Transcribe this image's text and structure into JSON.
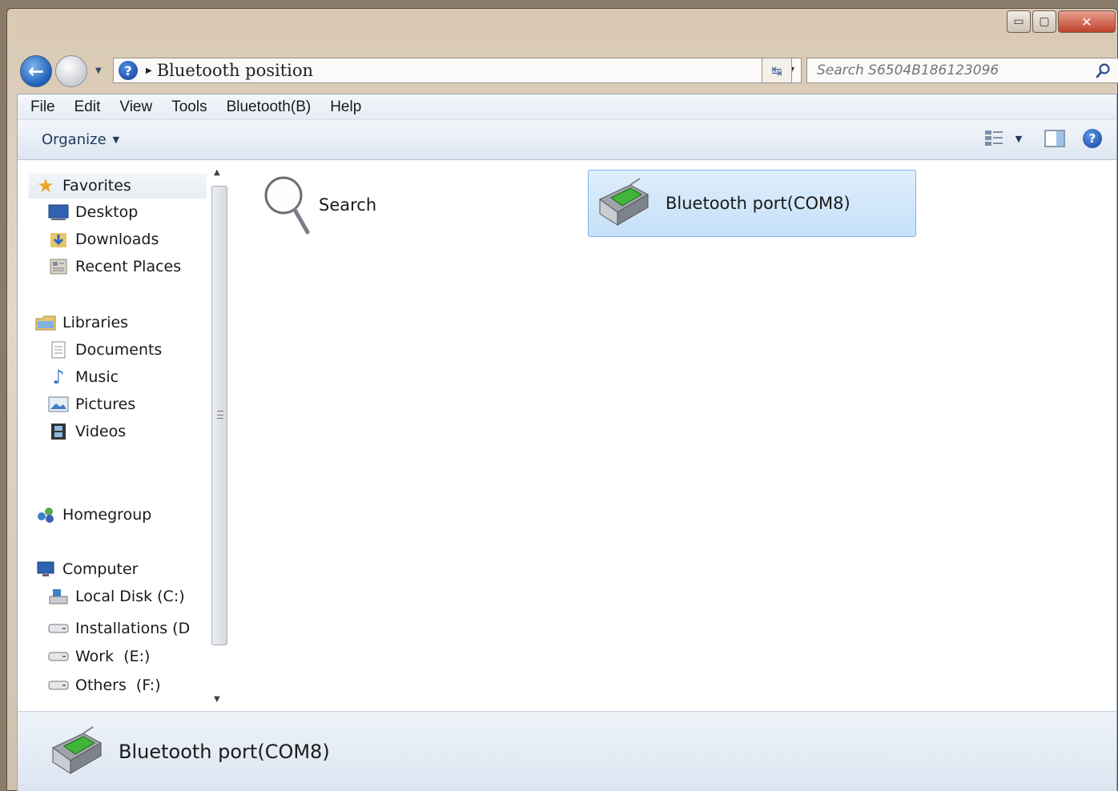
{
  "window": {
    "controls": {
      "minimize": "▭",
      "maximize": "▢",
      "close": "✕"
    }
  },
  "navigation": {
    "back_icon": "back-arrow-icon",
    "forward_icon": "forward-arrow-icon",
    "breadcrumb": "Bluetooth position",
    "search_placeholder": "Search S6504B186123096"
  },
  "menubar": {
    "items": [
      "File",
      "Edit",
      "View",
      "Tools",
      "Bluetooth(B)",
      "Help"
    ]
  },
  "commandbar": {
    "organize_label": "Organize"
  },
  "navpane": {
    "favorites": {
      "label": "Favorites",
      "items": [
        "Desktop",
        "Downloads",
        "Recent Places"
      ]
    },
    "libraries": {
      "label": "Libraries",
      "items": [
        "Documents",
        "Music",
        "Pictures",
        "Videos"
      ]
    },
    "homegroup": {
      "label": "Homegroup"
    },
    "computer": {
      "label": "Computer",
      "items": [
        "Local Disk (C:)",
        "Installations (D",
        "Work  (E:)",
        "Others  (F:)"
      ]
    }
  },
  "content": {
    "search_item": "Search",
    "bluetooth_item": "Bluetooth port(COM8)"
  },
  "details": {
    "selected_name": "Bluetooth port(COM8)"
  },
  "colors": {
    "selection_bg": "#c5e0f8",
    "selection_border": "#7eb4ea",
    "close_button": "#c0412a"
  }
}
